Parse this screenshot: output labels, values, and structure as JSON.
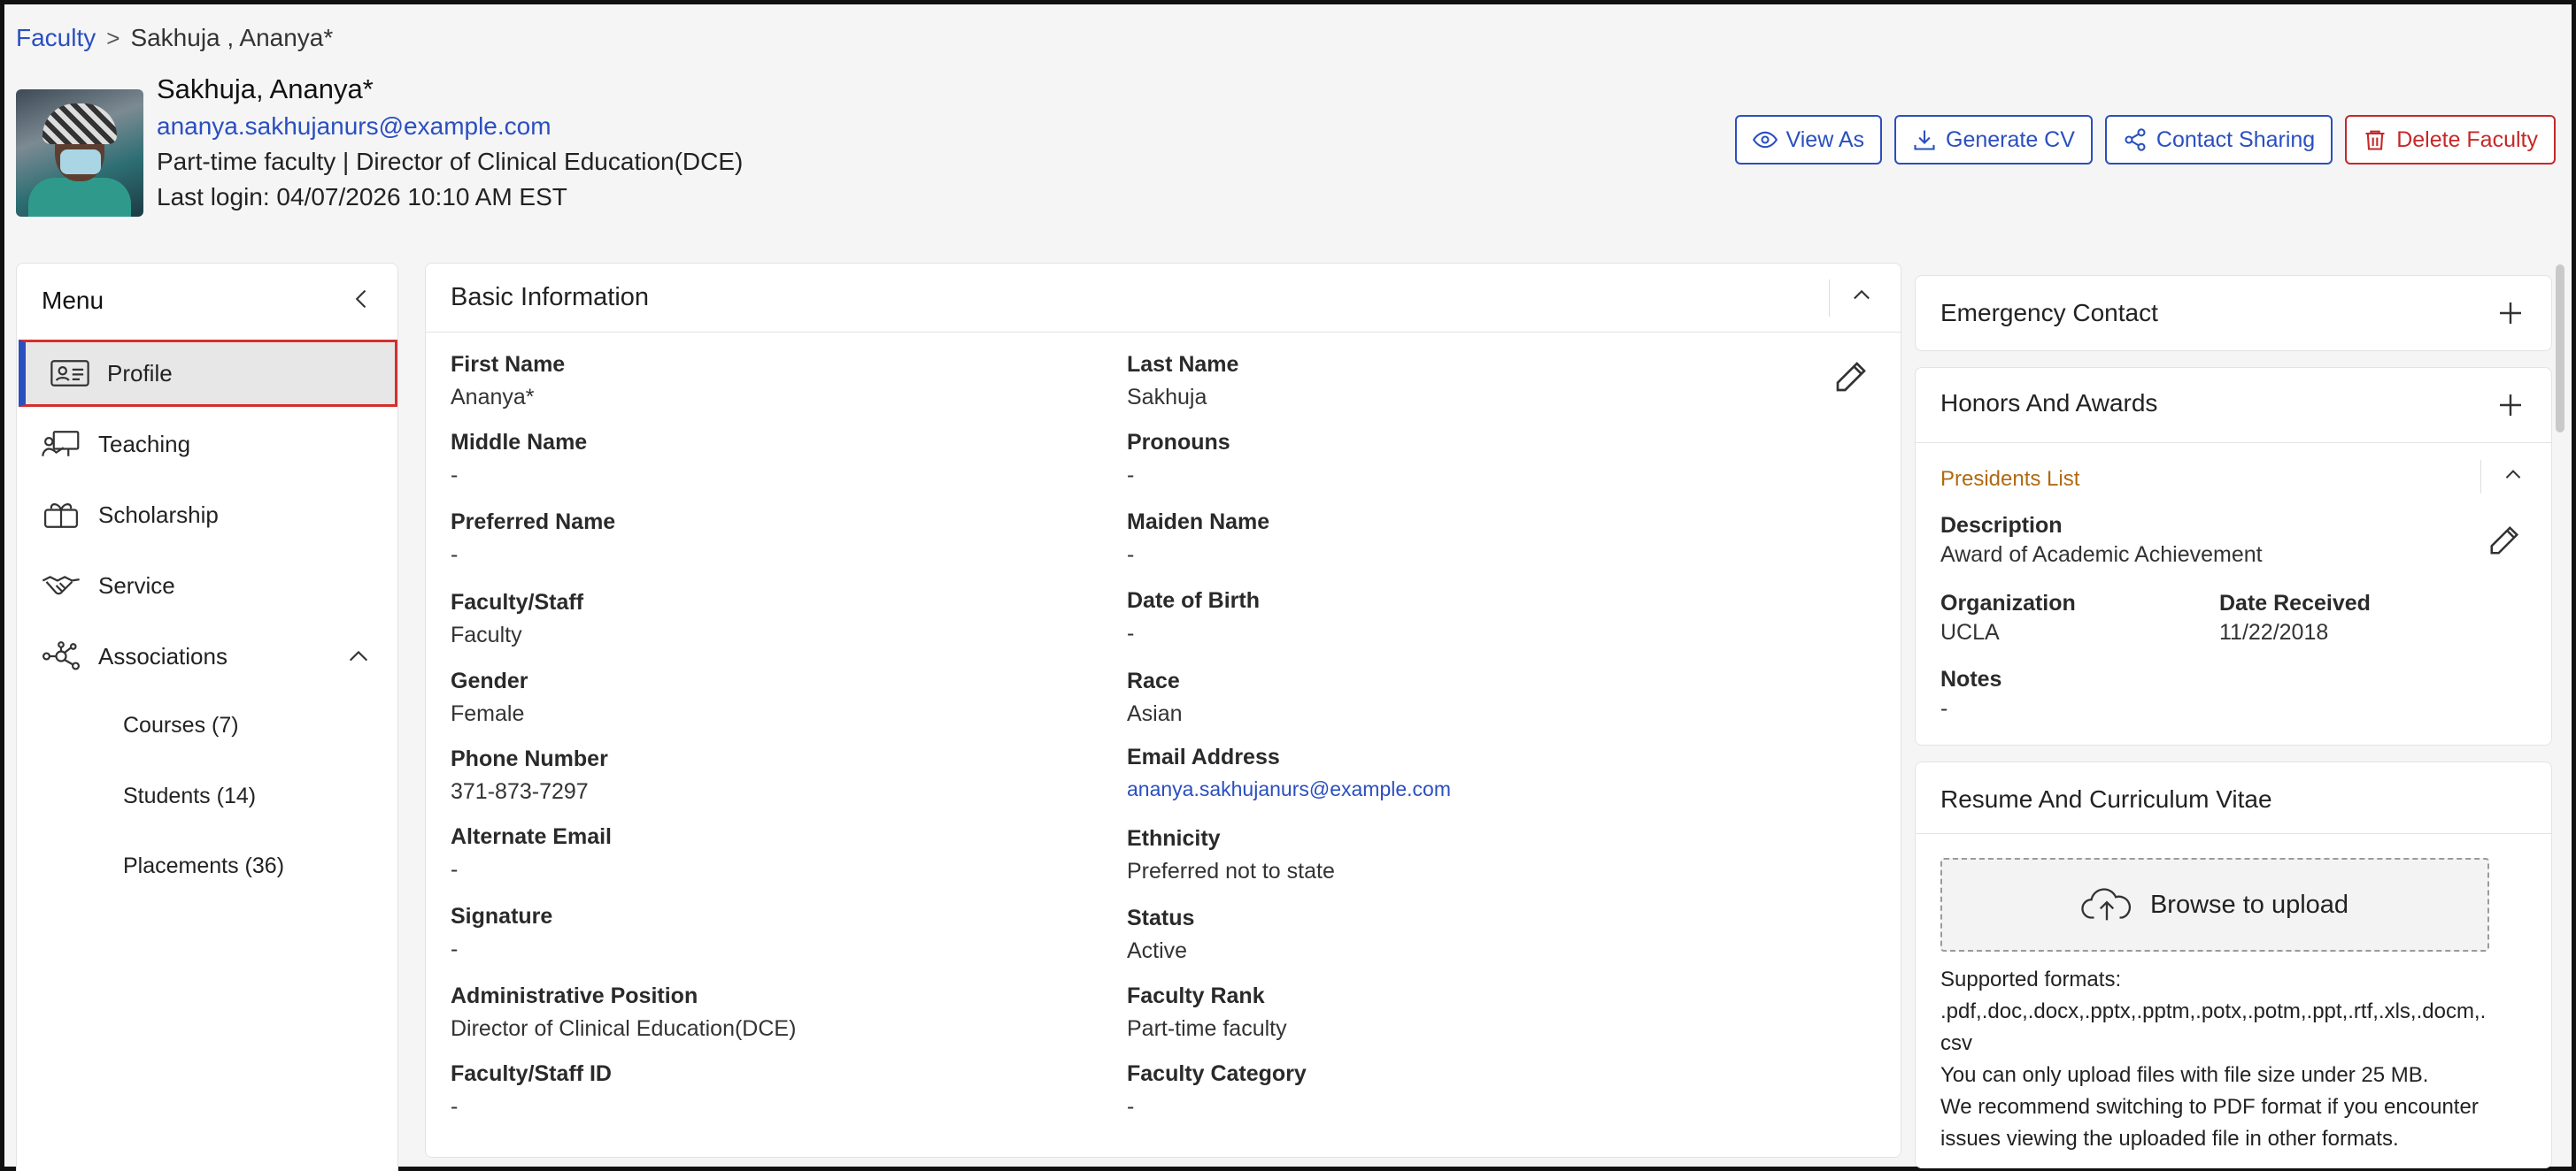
{
  "breadcrumb": {
    "parent": "Faculty",
    "separator": ">",
    "current": "Sakhuja , Ananya*"
  },
  "header": {
    "name": "Sakhuja, Ananya*",
    "email": "ananya.sakhujanurs@example.com",
    "role": "Part-time faculty | Director of Clinical Education(DCE)",
    "last_login": "Last login: 04/07/2026 10:10 AM EST",
    "actions": {
      "view_as": "View As",
      "generate_cv": "Generate CV",
      "contact_sharing": "Contact Sharing",
      "delete_faculty": "Delete Faculty"
    }
  },
  "sidebar": {
    "title": "Menu",
    "items": [
      {
        "label": "Profile",
        "icon": "id-card-icon"
      },
      {
        "label": "Teaching",
        "icon": "teacher-board-icon"
      },
      {
        "label": "Scholarship",
        "icon": "gift-award-icon"
      },
      {
        "label": "Service",
        "icon": "handshake-icon"
      },
      {
        "label": "Associations",
        "icon": "network-icon"
      }
    ],
    "sub_items": [
      "Courses (7)",
      "Students (14)",
      "Placements (36)"
    ]
  },
  "basic_info": {
    "title": "Basic Information",
    "fields": {
      "first_name": {
        "label": "First Name",
        "value": "Ananya*"
      },
      "last_name": {
        "label": "Last Name",
        "value": "Sakhuja"
      },
      "middle_name": {
        "label": "Middle Name",
        "value": "-"
      },
      "pronouns": {
        "label": "Pronouns",
        "value": "-"
      },
      "preferred_name": {
        "label": "Preferred Name",
        "value": "-"
      },
      "maiden_name": {
        "label": "Maiden Name",
        "value": "-"
      },
      "faculty_staff": {
        "label": "Faculty/Staff",
        "value": "Faculty"
      },
      "dob": {
        "label": "Date of Birth",
        "value": "-"
      },
      "gender": {
        "label": "Gender",
        "value": "Female"
      },
      "race": {
        "label": "Race",
        "value": "Asian"
      },
      "phone": {
        "label": "Phone Number",
        "value": "371-873-7297"
      },
      "email": {
        "label": "Email Address",
        "value": "ananya.sakhujanurs@example.com"
      },
      "alt_email": {
        "label": "Alternate Email",
        "value": "-"
      },
      "ethnicity": {
        "label": "Ethnicity",
        "value": "Preferred not to state"
      },
      "signature": {
        "label": "Signature",
        "value": "-"
      },
      "status": {
        "label": "Status",
        "value": "Active"
      },
      "admin_position": {
        "label": "Administrative Position",
        "value": "Director of Clinical Education(DCE)"
      },
      "faculty_rank": {
        "label": "Faculty Rank",
        "value": "Part-time faculty"
      },
      "staff_id": {
        "label": "Faculty/Staff ID",
        "value": "-"
      },
      "faculty_category": {
        "label": "Faculty Category",
        "value": "-"
      }
    }
  },
  "emergency_contact": {
    "title": "Emergency Contact"
  },
  "honors": {
    "title": "Honors And Awards",
    "award": {
      "name": "Presidents List",
      "description_label": "Description",
      "description": "Award of Academic Achievement",
      "organization_label": "Organization",
      "organization": "UCLA",
      "date_label": "Date Received",
      "date": "11/22/2018",
      "notes_label": "Notes",
      "notes": "-"
    }
  },
  "resume": {
    "title": "Resume And Curriculum Vitae",
    "upload_label": "Browse to upload",
    "formats_line1": "Supported formats:",
    "formats_line2": ".pdf,.doc,.docx,.pptx,.pptm,.potx,.potm,.ppt,.rtf,.xls,.docm,.",
    "formats_line3": "csv",
    "size_note": "You can only upload files with file size under 25 MB.",
    "pdf_note": "We recommend switching to PDF format if you encounter issues viewing the uploaded file in other formats."
  },
  "colors": {
    "link": "#2a4fbf",
    "danger": "#c62828",
    "award_title": "#b06a12",
    "active_border": "#d32f2f"
  }
}
